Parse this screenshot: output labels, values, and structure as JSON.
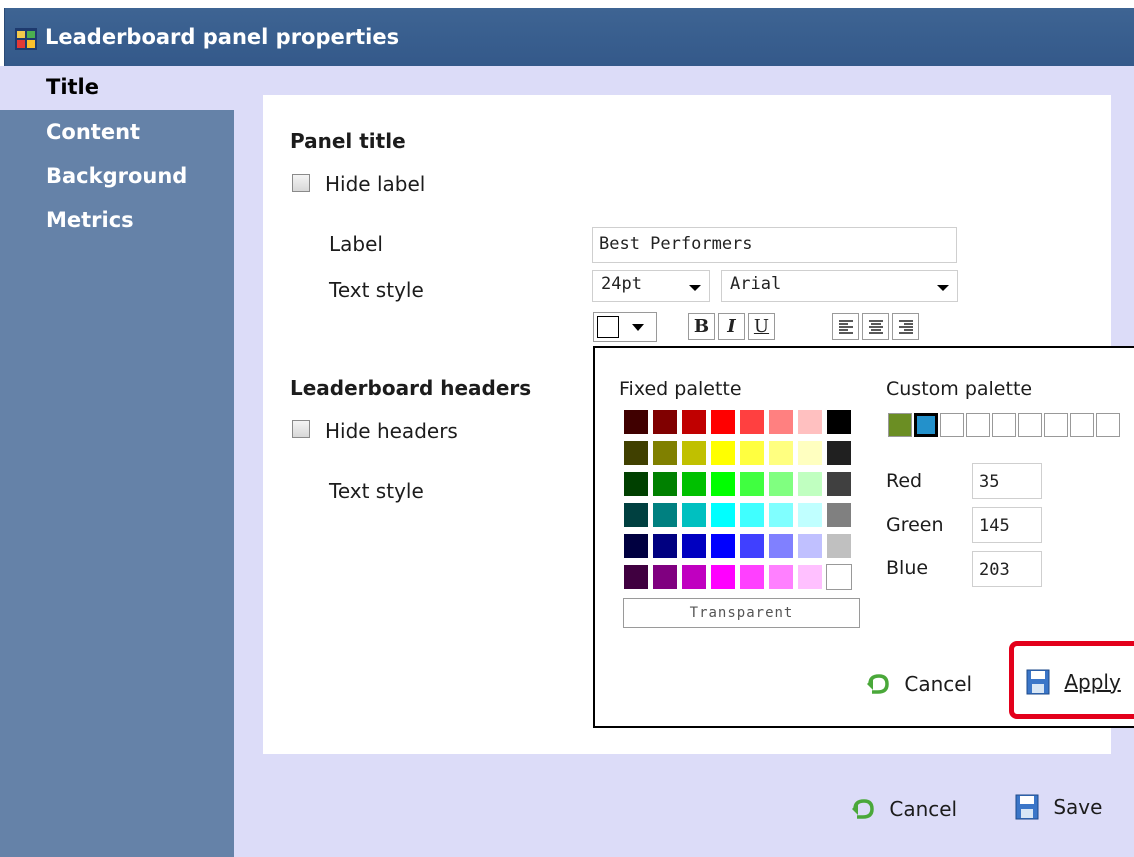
{
  "window": {
    "title": "Leaderboard panel properties"
  },
  "sidebar": {
    "items": [
      {
        "label": "Title",
        "active": true
      },
      {
        "label": "Content",
        "active": false
      },
      {
        "label": "Background",
        "active": false
      },
      {
        "label": "Metrics",
        "active": false
      }
    ]
  },
  "panel_title": {
    "heading": "Panel title",
    "hide_label": "Hide label",
    "label_caption": "Label",
    "label_value": "Best Performers",
    "text_style_caption": "Text style",
    "font_size": "24pt",
    "font_family": "Arial",
    "format_buttons": {
      "bold": "B",
      "italic": "I",
      "underline": "U"
    }
  },
  "headers": {
    "heading": "Leaderboard headers",
    "hide_headers": "Hide headers",
    "text_style_caption": "Text style"
  },
  "color_picker": {
    "fixed_palette_label": "Fixed palette",
    "custom_palette_label": "Custom palette",
    "transparent_label": "Transparent",
    "red_label": "Red",
    "green_label": "Green",
    "blue_label": "Blue",
    "red_value": "35",
    "green_value": "145",
    "blue_value": "203",
    "cancel_label": "Cancel",
    "apply_label": "Apply",
    "fixed_colors": [
      [
        "#400000",
        "#800000",
        "#c00000",
        "#ff0000",
        "#ff4040",
        "#ff8080",
        "#ffc0c0",
        "#000000"
      ],
      [
        "#404000",
        "#808000",
        "#c0c000",
        "#ffff00",
        "#ffff40",
        "#ffff80",
        "#ffffc0",
        "#202020"
      ],
      [
        "#004000",
        "#008000",
        "#00c000",
        "#00ff00",
        "#40ff40",
        "#80ff80",
        "#c0ffc0",
        "#404040"
      ],
      [
        "#004040",
        "#008080",
        "#00c0c0",
        "#00ffff",
        "#40ffff",
        "#80ffff",
        "#c0ffff",
        "#808080"
      ],
      [
        "#000040",
        "#000080",
        "#0000c0",
        "#0000ff",
        "#4040ff",
        "#8080ff",
        "#c0c0ff",
        "#c0c0c0"
      ],
      [
        "#400040",
        "#800080",
        "#c000c0",
        "#ff00ff",
        "#ff40ff",
        "#ff80ff",
        "#ffc0ff",
        "#ffffff"
      ]
    ],
    "custom_colors": [
      "#6b8e23",
      "#2391cb",
      "#ffffff",
      "#ffffff",
      "#ffffff",
      "#ffffff",
      "#ffffff",
      "#ffffff",
      "#ffffff"
    ]
  },
  "footer": {
    "cancel_label": "Cancel",
    "save_label": "Save"
  }
}
